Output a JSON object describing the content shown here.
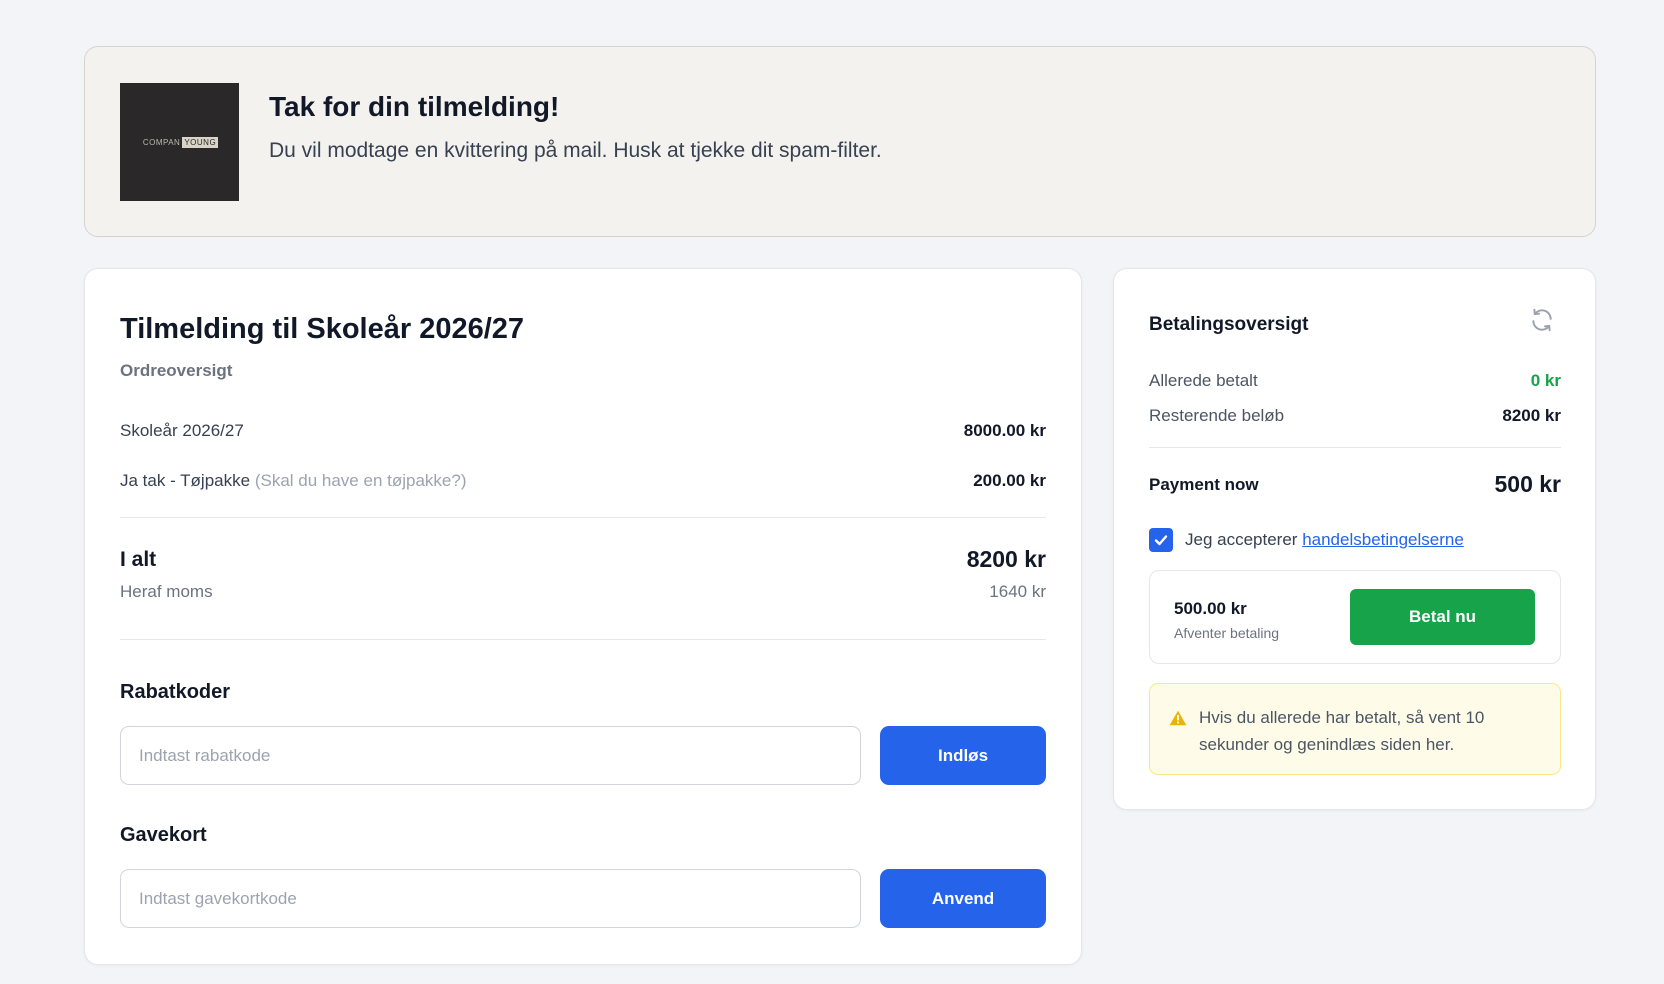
{
  "banner": {
    "logo_text_left": "COMPAN",
    "logo_text_right": "YOUNG",
    "title": "Tak for din tilmelding!",
    "subtitle": "Du vil modtage en kvittering på mail. Husk at tjekke dit spam-filter."
  },
  "order": {
    "title": "Tilmelding til Skoleår 2026/27",
    "subtitle": "Ordreoversigt",
    "items": [
      {
        "label": "Skoleår 2026/27",
        "note": "",
        "amount": "8000.00 kr"
      },
      {
        "label": "Ja tak - Tøjpakke",
        "note": "(Skal du have en tøjpakke?)",
        "amount": "200.00 kr"
      }
    ],
    "total_label": "I alt",
    "total_amount": "8200 kr",
    "vat_label": "Heraf moms",
    "vat_amount": "1640 kr",
    "discount": {
      "title": "Rabatkoder",
      "placeholder": "Indtast rabatkode",
      "value": "",
      "button": "Indløs"
    },
    "giftcard": {
      "title": "Gavekort",
      "placeholder": "Indtast gavekortkode",
      "value": "",
      "button": "Anvend"
    }
  },
  "payment": {
    "title": "Betalingsoversigt",
    "refresh_icon": "refresh-icon",
    "already_paid_label": "Allerede betalt",
    "already_paid_amount": "0 kr",
    "remaining_label": "Resterende beløb",
    "remaining_amount": "8200 kr",
    "pay_now_label": "Payment now",
    "pay_now_amount": "500 kr",
    "terms_checked": true,
    "terms_prefix": "Jeg accepterer",
    "terms_link": "handelsbetingelserne",
    "box_amount": "500.00 kr",
    "box_status": "Afventer betaling",
    "pay_button": "Betal nu",
    "warning_text": "Hvis du allerede har betalt, så vent 10 sekunder og genindlæs siden her.",
    "colors": {
      "accent_blue": "#2563eb",
      "success_green": "#16a34a",
      "warning_amber": "#eab308"
    }
  }
}
